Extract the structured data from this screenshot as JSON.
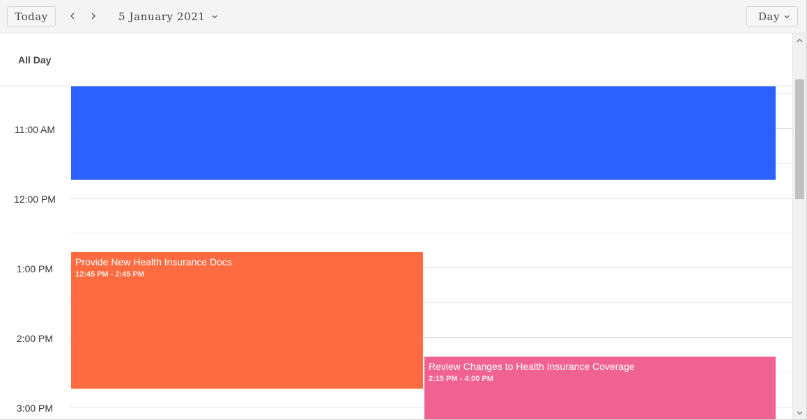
{
  "toolbar": {
    "today_label": "Today",
    "prev_icon": "chevron-left-icon",
    "next_icon": "chevron-right-icon",
    "date_label": "5 January 2021",
    "view_label": "Day"
  },
  "allday": {
    "label": "All Day"
  },
  "time_labels": [
    "11:00 AM",
    "12:00 PM",
    "1:00 PM",
    "2:00 PM",
    "3:00 PM"
  ],
  "events": [
    {
      "title": "",
      "time": "",
      "color": "#2b62ff"
    },
    {
      "title": "Provide New Health Insurance Docs",
      "time": "12:45 PM - 2:45 PM",
      "color": "#ff6b40"
    },
    {
      "title": "Review Changes to Health Insurance Coverage",
      "time": "2:15 PM - 4:00 PM",
      "color": "#f06292"
    }
  ]
}
